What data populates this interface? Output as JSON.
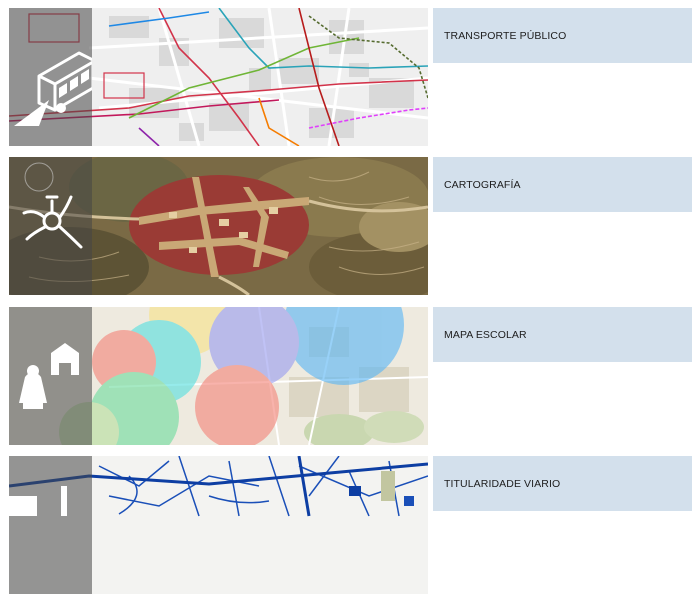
{
  "cards": [
    {
      "label": "TRANSPORTE PÚBLICO",
      "icon": "bus-icon",
      "map": "transit-map"
    },
    {
      "label": "CARTOGRAFÍA",
      "icon": "compass-icon",
      "map": "historic-map"
    },
    {
      "label": "MAPA ESCOLAR",
      "icon": "school-icon",
      "map": "school-map"
    },
    {
      "label": "TITULARIDADE VIARIO",
      "icon": "road-icon",
      "map": "road-ownership-map"
    }
  ],
  "colors": {
    "label_bg": "#d3e0ec",
    "icon_strip": "#5a5a5a"
  }
}
